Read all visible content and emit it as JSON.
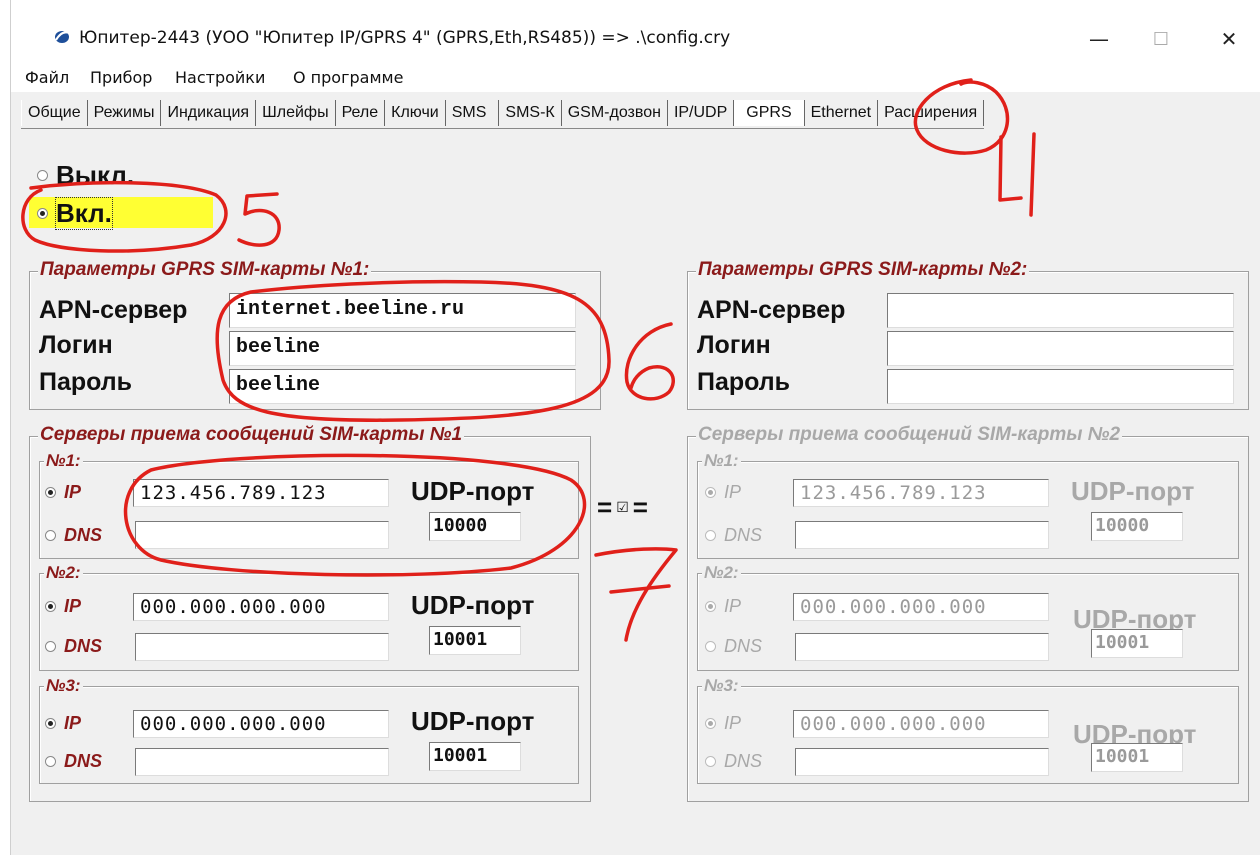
{
  "window": {
    "title": "Юпитер-2443 (УОО \"Юпитер IP/GPRS 4\" (GPRS,Eth,RS485))  =>  .\\config.cry",
    "minimize": "—",
    "maximize": "☐",
    "close": "✕"
  },
  "menu": [
    "Файл",
    "Прибор",
    "Настройки",
    "О программе"
  ],
  "tabs": [
    "Общие",
    "Режимы",
    "Индикация",
    "Шлейфы",
    "Реле",
    "Ключи",
    "SMS",
    "SMS-К",
    "GSM-дозвон",
    "IP/UDP",
    "GPRS",
    "Ethernet",
    "Расширения"
  ],
  "active_tab": "GPRS",
  "mode": {
    "off_label": "Выкл.",
    "on_label": "Вкл.",
    "selected": "Вкл."
  },
  "sim1": {
    "title": "Параметры GPRS SIM-карты №1:",
    "apn_label": "APN-сервер",
    "login_label": "Логин",
    "password_label": "Пароль",
    "apn_value": "internet.beeline.ru",
    "login_value": "beeline",
    "password_value": "beeline"
  },
  "sim2": {
    "title": "Параметры GPRS SIM-карты №2:",
    "apn_label": "APN-сервер",
    "login_label": "Логин",
    "password_label": "Пароль",
    "apn_value": "",
    "login_value": "",
    "password_value": ""
  },
  "servers1": {
    "title": "Серверы приема сообщений SIM-карты №1",
    "entries": [
      {
        "label": "№1:",
        "ip_label": "IP",
        "dns_label": "DNS",
        "ip": "123.456.789.123",
        "dns": "",
        "port_label": "UDP-порт",
        "port": "10000"
      },
      {
        "label": "№2:",
        "ip_label": "IP",
        "dns_label": "DNS",
        "ip": "000.000.000.000",
        "dns": "",
        "port_label": "UDP-порт",
        "port": "10001"
      },
      {
        "label": "№3:",
        "ip_label": "IP",
        "dns_label": "DNS",
        "ip": "000.000.000.000",
        "dns": "",
        "port_label": "UDP-порт",
        "port": "10001"
      }
    ]
  },
  "servers2": {
    "title": "Серверы приема сообщений SIM-карты №2",
    "entries": [
      {
        "label": "№1:",
        "ip_label": "IP",
        "dns_label": "DNS",
        "ip": "123.456.789.123",
        "dns": "",
        "port_label": "UDP-порт",
        "port": "10000"
      },
      {
        "label": "№2:",
        "ip_label": "IP",
        "dns_label": "DNS",
        "ip": "000.000.000.000",
        "dns": "",
        "port_label": "UDP-порт",
        "port": "10001"
      },
      {
        "label": "№3:",
        "ip_label": "IP",
        "dns_label": "DNS",
        "ip": "000.000.000.000",
        "dns": "",
        "port_label": "UDP-порт",
        "port": "10001"
      }
    ]
  },
  "same_servers": {
    "left": "=",
    "check": "☑",
    "right": "=",
    "checked": true
  },
  "annotations": [
    "4",
    "5",
    "6",
    "7"
  ],
  "colors": {
    "annotation": "#e0201a",
    "highlight": "#ffff33",
    "group_title": "#8b1a1a",
    "disabled": "#a8a8a8"
  }
}
